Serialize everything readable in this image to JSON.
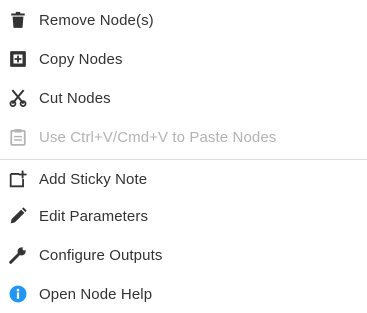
{
  "menu": {
    "items": [
      {
        "label": "Remove Node(s)",
        "icon": "trash-icon",
        "enabled": true
      },
      {
        "label": "Copy Nodes",
        "icon": "copy-plus-icon",
        "enabled": true
      },
      {
        "label": "Cut Nodes",
        "icon": "scissors-icon",
        "enabled": true
      },
      {
        "label": "Use Ctrl+V/Cmd+V to Paste Nodes",
        "icon": "clipboard-icon",
        "enabled": false
      },
      {
        "label": "Add Sticky Note",
        "icon": "sticky-note-add-icon",
        "enabled": true
      },
      {
        "label": "Edit Parameters",
        "icon": "pencil-icon",
        "enabled": true
      },
      {
        "label": "Configure Outputs",
        "icon": "wrench-icon",
        "enabled": true
      },
      {
        "label": "Open Node Help",
        "icon": "info-icon",
        "enabled": true
      }
    ]
  },
  "colors": {
    "text": "#333333",
    "disabled_text": "#b3b3b3",
    "info_icon": "#2196f3",
    "divider": "#dddddd"
  }
}
